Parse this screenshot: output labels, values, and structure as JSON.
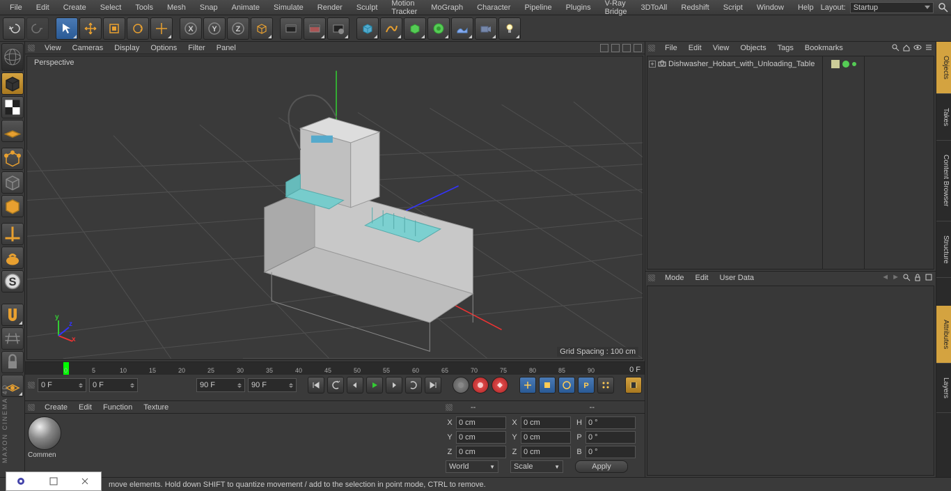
{
  "menu": {
    "items": [
      "File",
      "Edit",
      "Create",
      "Select",
      "Tools",
      "Mesh",
      "Snap",
      "Animate",
      "Simulate",
      "Render",
      "Sculpt",
      "Motion Tracker",
      "MoGraph",
      "Character",
      "Pipeline",
      "Plugins",
      "V-Ray Bridge",
      "3DToAll",
      "Redshift",
      "Script",
      "Window",
      "Help"
    ],
    "layout_label": "Layout:",
    "layout_value": "Startup"
  },
  "viewport": {
    "menu": [
      "View",
      "Cameras",
      "Display",
      "Options",
      "Filter",
      "Panel"
    ],
    "label": "Perspective",
    "grid": "Grid Spacing : 100 cm"
  },
  "timeline": {
    "ticks": [
      "0",
      "5",
      "10",
      "15",
      "20",
      "25",
      "30",
      "35",
      "40",
      "45",
      "50",
      "55",
      "60",
      "65",
      "70",
      "75",
      "80",
      "85",
      "90"
    ],
    "end_label": "0 F",
    "fields": {
      "f1": "0 F",
      "f2": "0 F",
      "f3": "90 F",
      "f4": "90 F"
    }
  },
  "materials": {
    "menu": [
      "Create",
      "Edit",
      "Function",
      "Texture"
    ],
    "item": "Commen"
  },
  "coords": {
    "dash": "--",
    "dash2": "--",
    "X": "0 cm",
    "Y": "0 cm",
    "Z": "0 cm",
    "X2": "0 cm",
    "Y2": "0 cm",
    "Z2": "0 cm",
    "H": "0 °",
    "P": "0 °",
    "B": "0 °",
    "world": "World",
    "scale": "Scale",
    "apply": "Apply"
  },
  "objects": {
    "menu": [
      "File",
      "Edit",
      "View",
      "Objects",
      "Tags",
      "Bookmarks"
    ],
    "item": "Dishwasher_Hobart_with_Unloading_Table"
  },
  "attributes": {
    "menu": [
      "Mode",
      "Edit",
      "User Data"
    ]
  },
  "side_tabs": [
    "Objects",
    "Takes",
    "Content Browser",
    "Structure",
    "Attributes",
    "Layers"
  ],
  "status": "move elements. Hold down SHIFT to quantize movement / add to the selection in point mode, CTRL to remove.",
  "brand": "MAXON CINEMA 4D"
}
